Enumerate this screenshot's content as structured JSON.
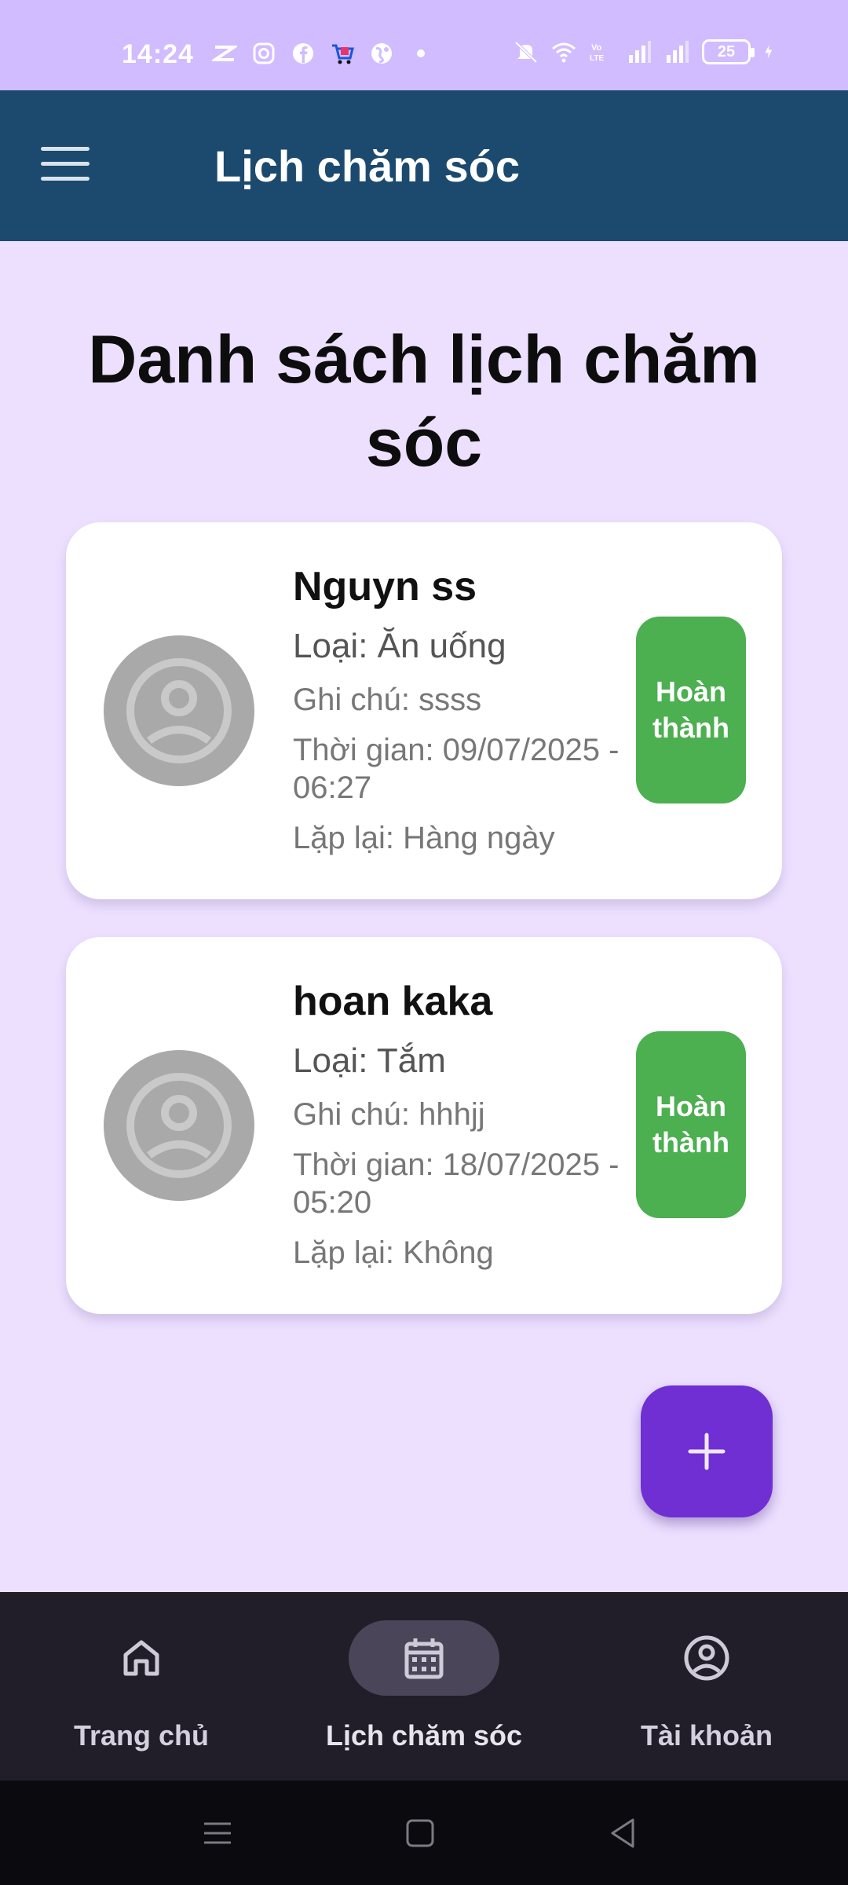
{
  "status_bar": {
    "time": "14:24",
    "battery": "25",
    "icons": [
      "capcut-icon",
      "instagram-icon",
      "facebook-icon",
      "shop-icon",
      "browser-icon",
      "dot-icon",
      "mute-icon",
      "wifi-icon",
      "volte-icon",
      "signal-icon",
      "signal-icon",
      "charging-icon"
    ]
  },
  "app_bar": {
    "title": "Lịch chăm sóc",
    "menu_icon": "menu-icon"
  },
  "page_title": "Danh sách lịch chăm sóc",
  "schedules": [
    {
      "name": "Nguyn  ss",
      "type": "Loại: Ăn uống",
      "note": "Ghi chú: ssss",
      "time": "Thời gian: 09/07/2025 - 06:27",
      "repeat": "Lặp lại: Hàng ngày",
      "button": "Hoàn thành"
    },
    {
      "name": "hoan kaka",
      "type": "Loại: Tắm",
      "note": "Ghi chú: hhhjj",
      "time": "Thời gian: 18/07/2025 - 05:20",
      "repeat": "Lặp lại: Không",
      "button": "Hoàn thành"
    }
  ],
  "fab": {
    "icon": "plus-icon"
  },
  "bottom_nav": {
    "items": [
      {
        "label": "Trang chủ",
        "icon": "home-icon",
        "active": false
      },
      {
        "label": "Lịch chăm sóc",
        "icon": "calendar-icon",
        "active": true
      },
      {
        "label": "Tài khoản",
        "icon": "account-icon",
        "active": false
      }
    ]
  },
  "system_nav": [
    "recents-icon",
    "home-square-icon",
    "back-icon"
  ],
  "colors": {
    "status_bar": "#d0bcff",
    "app_bar": "#1b4a6e",
    "background": "#ede0ff",
    "done_button": "#4caf50",
    "fab": "#6f2fd3",
    "bottom_nav": "#211e29"
  }
}
